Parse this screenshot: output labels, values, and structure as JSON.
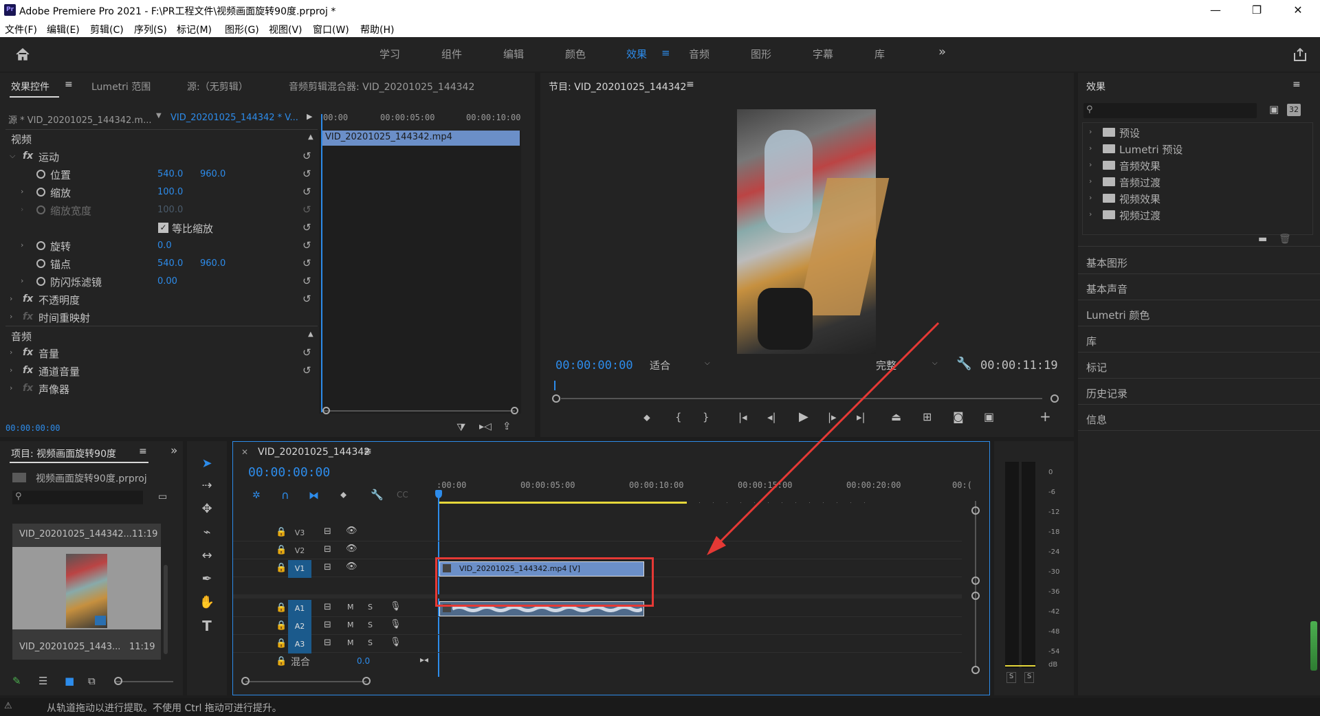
{
  "window": {
    "title": "Adobe Premiere Pro 2021 - F:\\PR工程文件\\视频画面旋转90度.prproj *",
    "app_icon": "Pr",
    "controls": [
      "—",
      "❐",
      "✕"
    ]
  },
  "menu": [
    "文件(F)",
    "编辑(E)",
    "剪辑(C)",
    "序列(S)",
    "标记(M)",
    "图形(G)",
    "视图(V)",
    "窗口(W)",
    "帮助(H)"
  ],
  "workspaces": {
    "items": [
      "学习",
      "组件",
      "编辑",
      "颜色",
      "效果",
      "音频",
      "图形",
      "字幕",
      "库"
    ],
    "active": "效果",
    "more": "»"
  },
  "effect_controls": {
    "tabs": [
      "效果控件",
      "Lumetri 范围",
      "源:（无剪辑）",
      "音频剪辑混合器: VID_20201025_144342"
    ],
    "source_label": "源 * VID_20201025_144342.m...",
    "sequence_label": "VID_20201025_144342 * V...",
    "section_video": "视频",
    "motion": "运动",
    "position": {
      "label": "位置",
      "x": "540.0",
      "y": "960.0"
    },
    "scale": {
      "label": "缩放",
      "value": "100.0"
    },
    "scale_width": {
      "label": "缩放宽度",
      "value": "100.0"
    },
    "uniform_scale": "等比缩放",
    "rotation": {
      "label": "旋转",
      "value": "0.0"
    },
    "anchor": {
      "label": "锚点",
      "x": "540.0",
      "y": "960.0"
    },
    "anti_flicker": {
      "label": "防闪烁滤镜",
      "value": "0.00"
    },
    "opacity": "不透明度",
    "time_remap": "时间重映射",
    "section_audio": "音频",
    "volume": "音量",
    "channel_volume": "通道音量",
    "panner": "声像器",
    "ruler": [
      "00:00",
      "00:00:05:00",
      "00:00:10:00"
    ],
    "clip_name": "VID_20201025_144342.mp4",
    "timecode": "00:00:00:00"
  },
  "program_monitor": {
    "title": "节目: VID_20201025_144342",
    "timecode": "00:00:00:00",
    "fit": "适合",
    "quality": "完整",
    "duration": "00:00:11:19"
  },
  "effects_panel": {
    "title": "效果",
    "items": [
      "预设",
      "Lumetri 预设",
      "音频效果",
      "音频过渡",
      "视频效果",
      "视频过渡"
    ],
    "icon_labels": [
      "32"
    ]
  },
  "right_sections": [
    "基本图形",
    "基本声音",
    "Lumetri 颜色",
    "库",
    "标记",
    "历史记录",
    "信息"
  ],
  "project_panel": {
    "title": "项目: 视频画面旋转90度",
    "file": "视频画面旋转90度.prproj",
    "clip_top": "VID_20201025_144342...11:19",
    "clip_name": "VID_20201025_1443...",
    "clip_duration": "11:19"
  },
  "timeline": {
    "title": "VID_20201025_144342",
    "timecode": "00:00:00:00",
    "ruler": [
      ":00:00",
      "00:00:05:00",
      "00:00:10:00",
      "00:00:15:00",
      "00:00:20:00",
      "00:("
    ],
    "tracks": [
      "V3",
      "V2",
      "V1",
      "A1",
      "A2",
      "A3"
    ],
    "mix_label": "混合",
    "mix_value": "0.0",
    "video_clip": "VID_20201025_144342.mp4 [V]",
    "m_label": "M",
    "s_label": "S"
  },
  "meter": {
    "labels": [
      "0",
      "-6",
      "-12",
      "-18",
      "-24",
      "-30",
      "-36",
      "-42",
      "-48",
      "-54",
      "dB"
    ],
    "solo": [
      "S",
      "S"
    ]
  },
  "statusbar": "从轨道拖动以进行提取。不使用 Ctrl 拖动可进行提升。",
  "colors": {
    "accent": "#2d8ceb",
    "annotation": "#e53935",
    "clip_video": "#6b8fc8",
    "clip_audio": "#4f6a8a"
  }
}
